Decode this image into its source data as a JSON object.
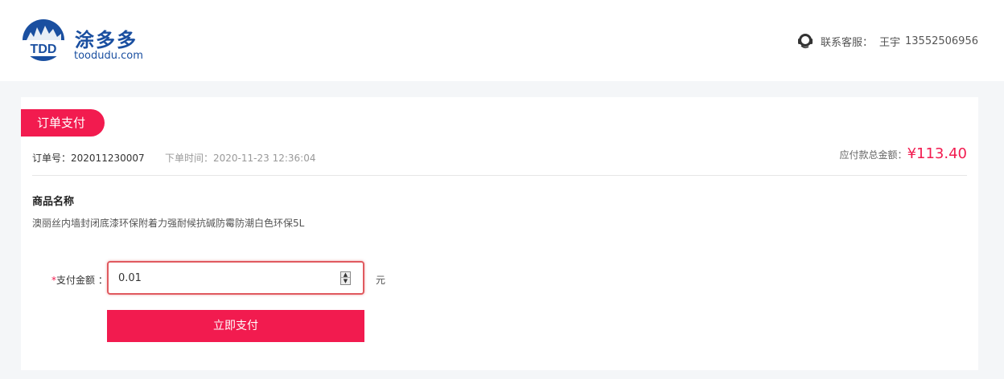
{
  "header": {
    "logo_mark_text": "TDD",
    "logo_name": "涂多多",
    "logo_domain": "toodudu.com",
    "service_label": "联系客服：",
    "service_name": "王宇",
    "service_phone": "13552506956"
  },
  "order": {
    "section_title": "订单支付",
    "order_no_label": "订单号：",
    "order_no": "202011230007",
    "order_time_label": "下单时间：",
    "order_time": "2020-11-23 12:36:04",
    "total_label": "应付款总金额：",
    "total_amount": "¥113.40"
  },
  "goods": {
    "heading": "商品名称",
    "name": "澳丽丝内墙封闭底漆环保附着力强耐候抗碱防霉防潮白色环保5L"
  },
  "payment": {
    "required_mark": "*",
    "amount_label": "支付金额 ：",
    "amount_value": "0.01",
    "unit": "元",
    "submit_label": "立即支付"
  },
  "colors": {
    "accent": "#f21b4f",
    "brand": "#1a4fa0"
  }
}
